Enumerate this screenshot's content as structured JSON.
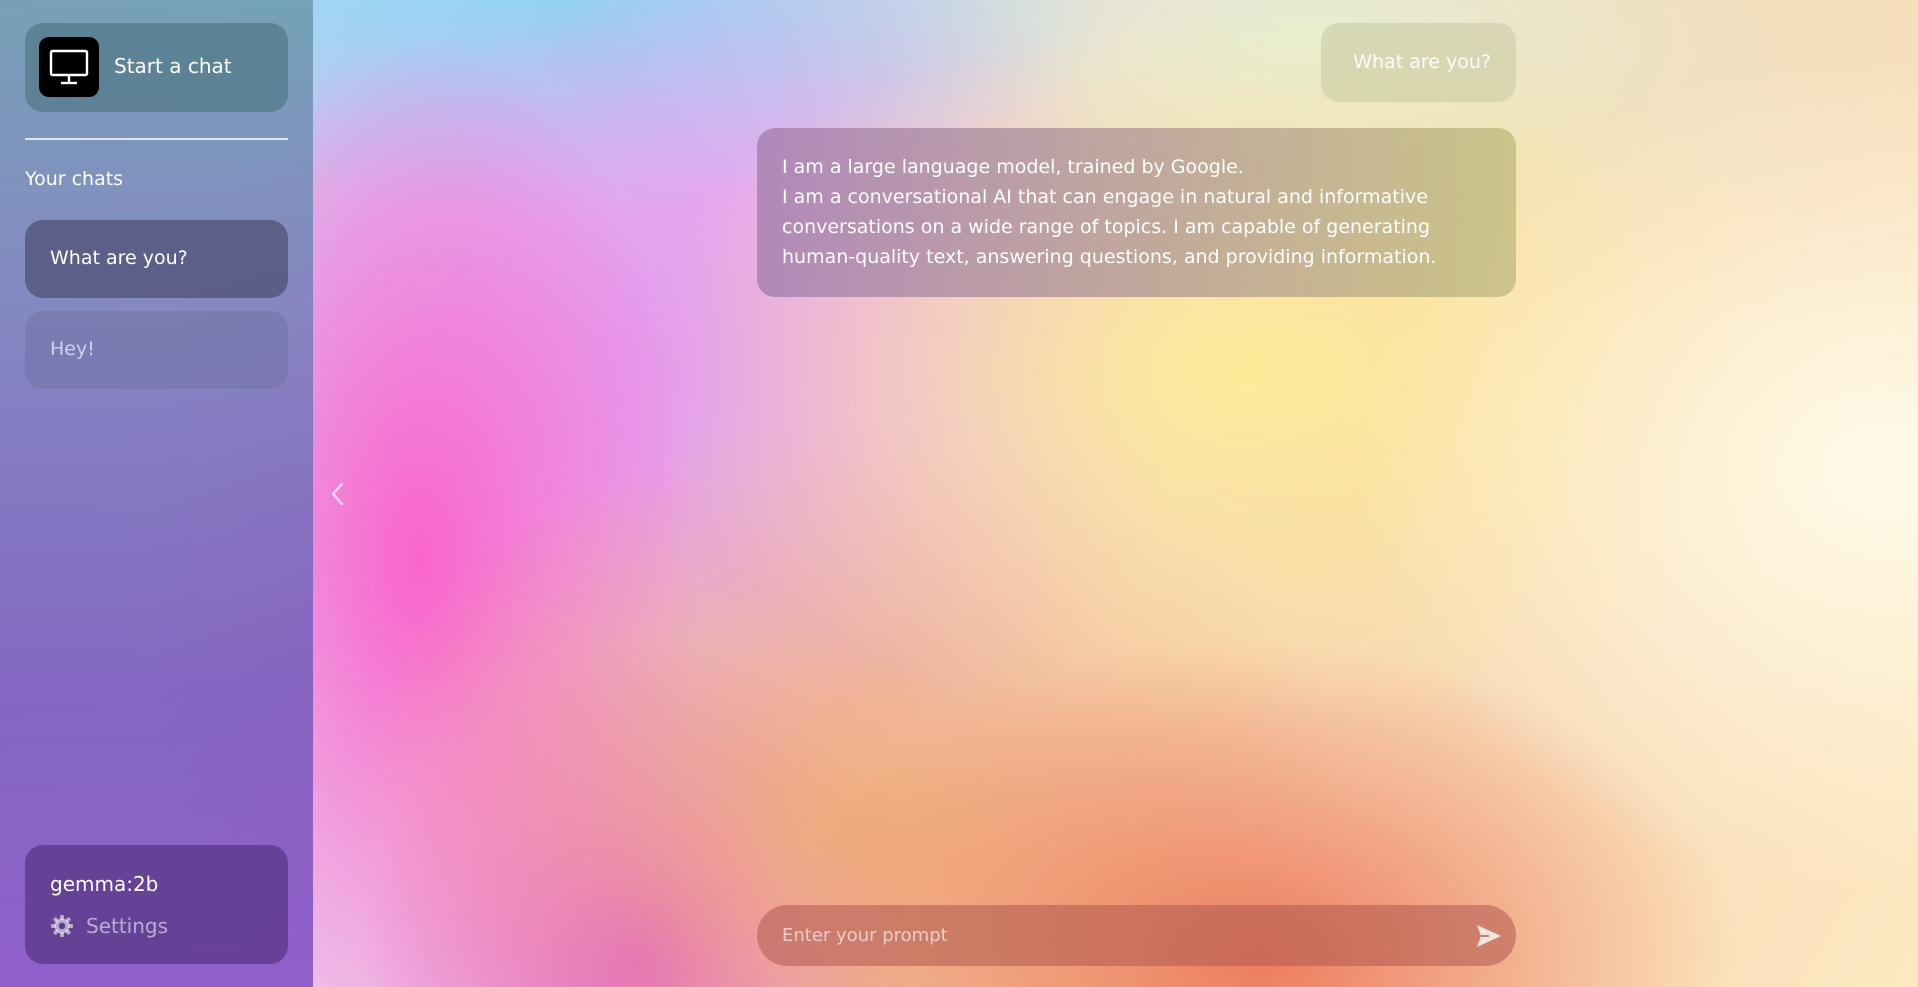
{
  "sidebar": {
    "start_chat_label": "Start a chat",
    "start_chat_icon": "monitor-icon",
    "section_title": "Your chats",
    "chats": [
      {
        "title": "What are you?",
        "active": true
      },
      {
        "title": "Hey!",
        "active": false
      }
    ],
    "model": "gemma:2b",
    "settings_label": "Settings",
    "settings_icon": "gear-icon"
  },
  "toggle": {
    "icon": "chevron-left-icon"
  },
  "conversation": {
    "user_message": "What are you?",
    "assistant_lines": [
      "I am a large language model, trained by Google.",
      "I am a conversational AI that can engage in natural and informative",
      "conversations on a wide range of topics. I am capable of generating",
      "human-quality text, answering questions, and providing information."
    ]
  },
  "composer": {
    "placeholder": "Enter your prompt",
    "value": "",
    "send_icon": "send-icon"
  }
}
